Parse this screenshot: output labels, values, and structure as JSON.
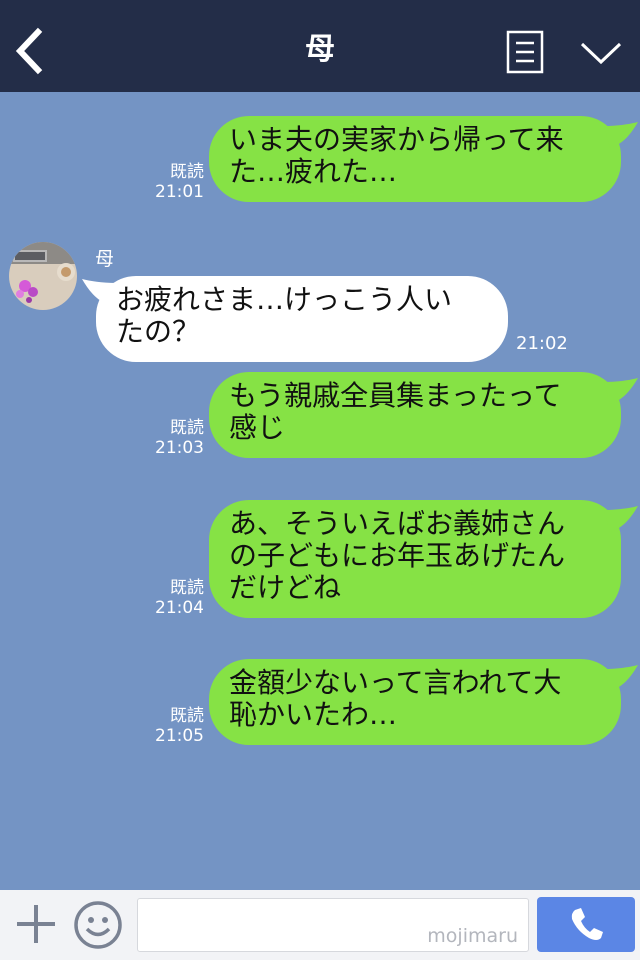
{
  "header": {
    "title": "母"
  },
  "contact": {
    "name": "母"
  },
  "messages": [
    {
      "from": "me",
      "lines": [
        "いま夫の実家から帰って来",
        "た…疲れた…"
      ],
      "read": "既読",
      "time": "21:01"
    },
    {
      "from": "them",
      "lines": [
        "お疲れさま…けっこう人い",
        "たの？"
      ],
      "time": "21:02"
    },
    {
      "from": "me",
      "lines": [
        "もう親戚全員集まったって",
        "感じ"
      ],
      "read": "既読",
      "time": "21:03"
    },
    {
      "from": "me",
      "lines": [
        "あ、そういえばお義姉さん",
        "の子どもにお年玉あげたん",
        "だけどね"
      ],
      "read": "既読",
      "time": "21:04"
    },
    {
      "from": "me",
      "lines": [
        "金額少ないって言われて大",
        "恥かいたわ…"
      ],
      "read": "既読",
      "time": "21:05"
    }
  ],
  "footer": {
    "watermark": "mojimaru"
  },
  "icons": {
    "back": "chevron-left-icon",
    "memo": "notes-icon",
    "menu": "chevron-down-icon",
    "plus": "plus-icon",
    "emoji": "smiley-icon",
    "call": "phone-icon"
  },
  "colors": {
    "header_bg": "#232d48",
    "chat_bg": "#7494c4",
    "my_bubble": "#86e245",
    "their_bubble": "#ffffff",
    "call_button": "#5b86e5"
  }
}
